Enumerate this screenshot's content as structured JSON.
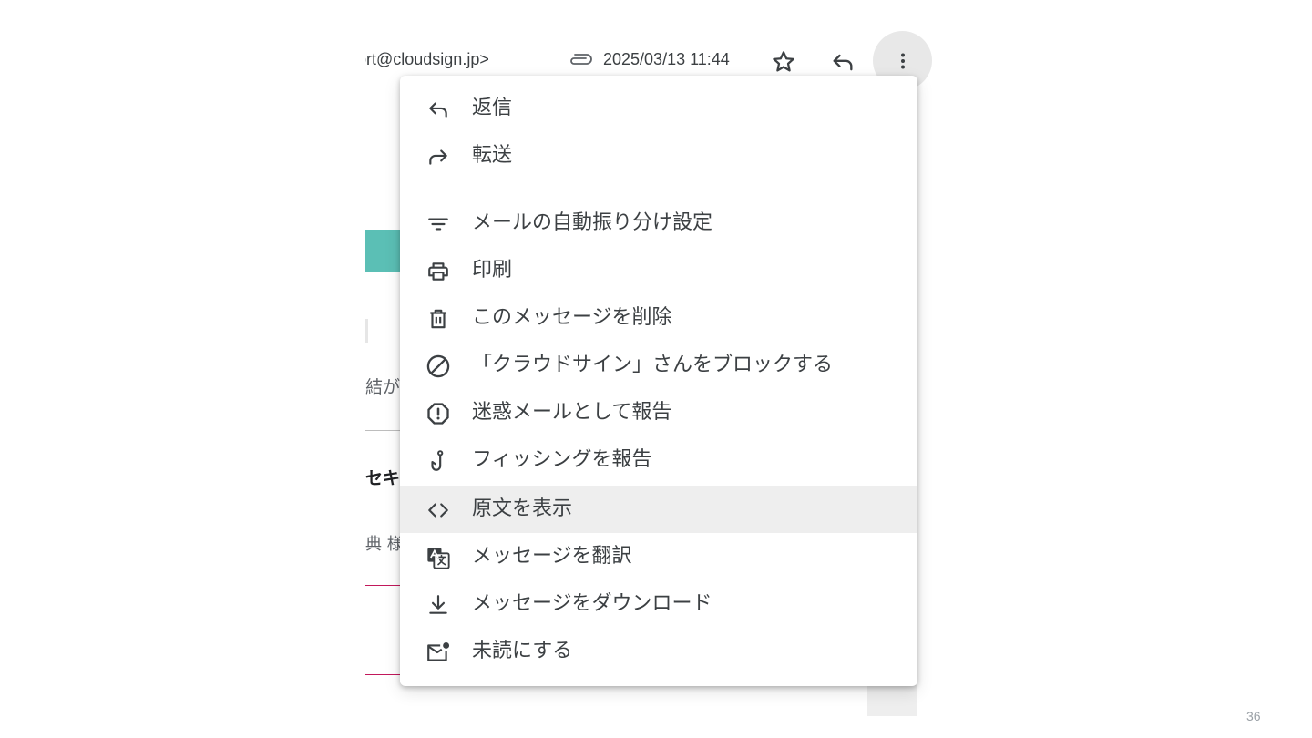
{
  "header": {
    "sender": "ɔrt@cloudsign.jp>",
    "date": "2025/03/13 11:44"
  },
  "background": {
    "text1": "結が",
    "text2": "セキ",
    "text3": "典 様"
  },
  "menu": {
    "items": [
      {
        "label": "返信",
        "icon": "reply-icon"
      },
      {
        "label": "転送",
        "icon": "forward-icon"
      },
      {
        "label": "メールの自動振り分け設定",
        "icon": "filter-icon"
      },
      {
        "label": "印刷",
        "icon": "print-icon"
      },
      {
        "label": "このメッセージを削除",
        "icon": "trash-icon"
      },
      {
        "label": "「クラウドサイン」さんをブロックする",
        "icon": "block-icon"
      },
      {
        "label": "迷惑メールとして報告",
        "icon": "spam-icon"
      },
      {
        "label": "フィッシングを報告",
        "icon": "phishing-hook-icon"
      },
      {
        "label": "原文を表示",
        "icon": "code-icon"
      },
      {
        "label": "メッセージを翻訳",
        "icon": "translate-icon"
      },
      {
        "label": "メッセージをダウンロード",
        "icon": "download-icon"
      },
      {
        "label": "未読にする",
        "icon": "mark-unread-icon"
      }
    ],
    "highlighted_index": 8
  },
  "page_number": "36",
  "colors": {
    "menu_hover": "#eeeeee",
    "accent_teal": "#5bbfb5",
    "icon": "#3c4043"
  }
}
